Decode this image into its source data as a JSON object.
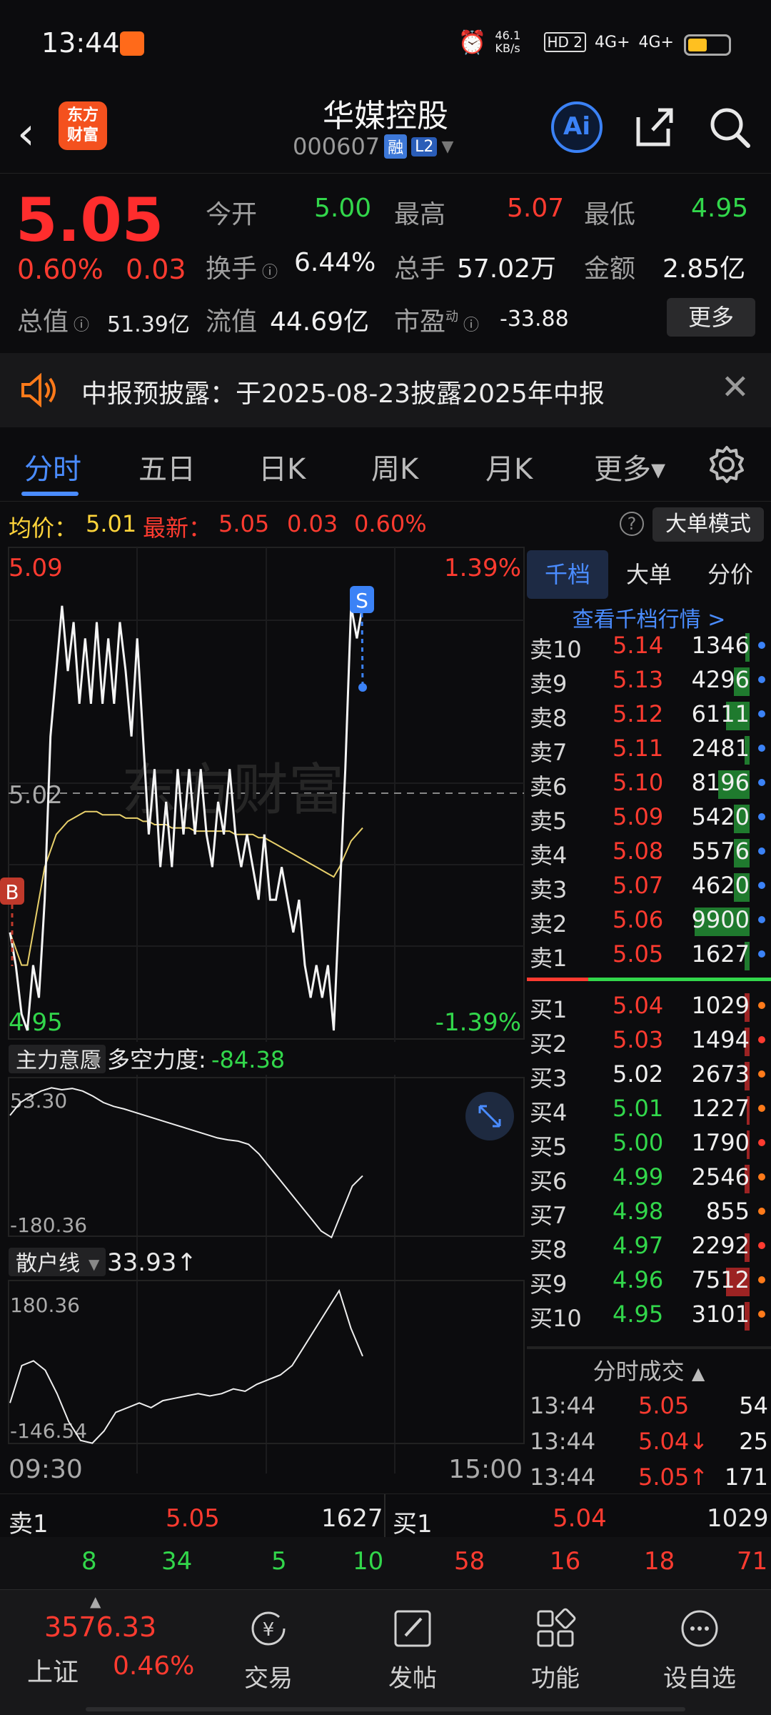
{
  "status": {
    "time": "13:44",
    "net_speed": "46.1 KB/s",
    "hd": "HD 2",
    "sig1": "4G+",
    "sig2": "4G+"
  },
  "header": {
    "back": "‹",
    "logo_text1": "东方",
    "logo_text2": "财富",
    "stock_name": "华媒控股",
    "stock_code": "000607",
    "tag1": "融",
    "tag2": "L2",
    "ai": "Ai"
  },
  "quote": {
    "price": "5.05",
    "change_pct": "0.60%",
    "change_abs": "0.03",
    "open_label": "今开",
    "open": "5.00",
    "high_label": "最高",
    "high": "5.07",
    "low_label": "最低",
    "low": "4.95",
    "turnover_label": "换手",
    "turnover": "6.44%",
    "volume_label": "总手",
    "volume": "57.02万",
    "amount_label": "金额",
    "amount": "2.85亿",
    "total_value_label": "总值",
    "total_value": "51.39亿",
    "float_value_label": "流值",
    "float_value": "44.69亿",
    "pe_label": "市盈",
    "pe_sup": "动",
    "pe": "-33.88",
    "more": "更多"
  },
  "notice": {
    "text": "中报预披露：于2025-08-23披露2025年中报"
  },
  "tabs": [
    {
      "label": "分时"
    },
    {
      "label": "五日"
    },
    {
      "label": "日K"
    },
    {
      "label": "周K"
    },
    {
      "label": "月K"
    },
    {
      "label": "更多▾"
    }
  ],
  "info": {
    "avg_label": "均价：",
    "avg": "5.01",
    "latest_label": "最新：",
    "latest": "5.05",
    "latest_chg": "0.03",
    "latest_pct": "0.60%",
    "big_order_mode": "大单模式"
  },
  "chart_data": {
    "type": "line",
    "price_axis": {
      "top": "5.09",
      "mid": "5.02",
      "bottom": "4.95",
      "top_pct": "1.39%",
      "bottom_pct": "-1.39%"
    },
    "time_axis": {
      "start": "09:30",
      "end": "15:00"
    },
    "watermark": "东方财富",
    "markers": {
      "buy": "B",
      "sell": "S"
    },
    "price_series": [
      4.98,
      4.97,
      4.955,
      4.95,
      4.97,
      4.96,
      4.99,
      5.04,
      5.06,
      5.08,
      5.06,
      5.075,
      5.05,
      5.07,
      5.05,
      5.075,
      5.05,
      5.07,
      5.05,
      5.075,
      5.06,
      5.04,
      5.07,
      5.04,
      5.01,
      5.03,
      5.0,
      5.02,
      5.0,
      5.03,
      5.01,
      5.03,
      5.01,
      5.03,
      5.01,
      5.0,
      5.02,
      5.01,
      5.03,
      5.01,
      5.0,
      5.01,
      5.0,
      4.99,
      5.01,
      4.99,
      4.99,
      5.0,
      4.99,
      4.98,
      4.99,
      4.97,
      4.96,
      4.97,
      4.96,
      4.97,
      4.95,
      4.99,
      5.03,
      5.08,
      5.07,
      5.08
    ],
    "avg_series": [
      4.98,
      4.975,
      4.97,
      4.97,
      4.98,
      4.99,
      5.0,
      5.005,
      5.01,
      5.012,
      5.014,
      5.015,
      5.016,
      5.017,
      5.017,
      5.017,
      5.016,
      5.016,
      5.016,
      5.016,
      5.015,
      5.015,
      5.015,
      5.014,
      5.014,
      5.013,
      5.013,
      5.013,
      5.012,
      5.012,
      5.012,
      5.012,
      5.011,
      5.011,
      5.011,
      5.011,
      5.011,
      5.011,
      5.011,
      5.01,
      5.01,
      5.01,
      5.01,
      5.009,
      5.009,
      5.008,
      5.007,
      5.006,
      5.005,
      5.004,
      5.003,
      5.002,
      5.001,
      5.0,
      4.999,
      4.998,
      4.997,
      5.0,
      5.004,
      5.008,
      5.01,
      5.012
    ],
    "indicator1": {
      "name": "主力意愿",
      "label": "多空力度:",
      "value": "-84.38",
      "max": "53.30",
      "min": "-180.36",
      "series": [
        10,
        30,
        40,
        48,
        53,
        50,
        52,
        48,
        40,
        30,
        24,
        20,
        15,
        10,
        5,
        0,
        -5,
        -10,
        -15,
        -20,
        -25,
        -28,
        -30,
        -35,
        -50,
        -70,
        -90,
        -110,
        -130,
        -150,
        -170,
        -180,
        -140,
        -100,
        -84
      ]
    },
    "indicator2": {
      "name": "散户线",
      "value": "33.93↑",
      "max": "180.36",
      "min": "-146.54",
      "series": [
        -60,
        20,
        30,
        10,
        -40,
        -100,
        -140,
        -146,
        -120,
        -80,
        -70,
        -60,
        -70,
        -55,
        -50,
        -45,
        -40,
        -45,
        -40,
        -30,
        -35,
        -20,
        -10,
        0,
        20,
        60,
        100,
        140,
        180,
        100,
        40
      ]
    }
  },
  "orderbook": {
    "tabs": [
      {
        "label": "千档"
      },
      {
        "label": "大单"
      },
      {
        "label": "分价"
      }
    ],
    "link": "查看千档行情 >",
    "sell": [
      {
        "label": "卖10",
        "price": "5.14",
        "vol": "1346",
        "bar": 0.05
      },
      {
        "label": "卖9",
        "price": "5.13",
        "vol": "4296",
        "bar": 0.2
      },
      {
        "label": "卖8",
        "price": "5.12",
        "vol": "6111",
        "bar": 0.3
      },
      {
        "label": "卖7",
        "price": "5.11",
        "vol": "2481",
        "bar": 0.06
      },
      {
        "label": "卖6",
        "price": "5.10",
        "vol": "8196",
        "bar": 0.4
      },
      {
        "label": "卖5",
        "price": "5.09",
        "vol": "5420",
        "bar": 0.2
      },
      {
        "label": "卖4",
        "price": "5.08",
        "vol": "5576",
        "bar": 0.2
      },
      {
        "label": "卖3",
        "price": "5.07",
        "vol": "4620",
        "bar": 0.2
      },
      {
        "label": "卖2",
        "price": "5.06",
        "vol": "9900",
        "bar": 0.7
      },
      {
        "label": "卖1",
        "price": "5.05",
        "vol": "1627",
        "bar": 0.06
      }
    ],
    "buy": [
      {
        "label": "买1",
        "price": "5.04",
        "vol": "1029",
        "bar": 0.06
      },
      {
        "label": "买2",
        "price": "5.03",
        "vol": "1494",
        "bar": 0.06
      },
      {
        "label": "买3",
        "price": "5.02",
        "vol": "2673",
        "bar": 0.06
      },
      {
        "label": "买4",
        "price": "5.01",
        "vol": "1227",
        "bar": 0.04
      },
      {
        "label": "买5",
        "price": "5.00",
        "vol": "1790",
        "bar": 0.04
      },
      {
        "label": "买6",
        "price": "4.99",
        "vol": "2546",
        "bar": 0.06
      },
      {
        "label": "买7",
        "price": "4.98",
        "vol": "855",
        "bar": 0.0
      },
      {
        "label": "买8",
        "price": "4.97",
        "vol": "2292",
        "bar": 0.06
      },
      {
        "label": "买9",
        "price": "4.96",
        "vol": "7512",
        "bar": 0.3
      },
      {
        "label": "买10",
        "price": "4.95",
        "vol": "3101",
        "bar": 0.06
      }
    ],
    "trades_title": "分时成交",
    "trades": [
      {
        "time": "13:44",
        "price": "5.05",
        "vol": "54"
      },
      {
        "time": "13:44",
        "price": "5.04↓",
        "vol": "25"
      },
      {
        "time": "13:44",
        "price": "5.05↑",
        "vol": "171"
      }
    ]
  },
  "summary": {
    "sell_label": "卖1",
    "sell_price": "5.05",
    "sell_vol": "1627",
    "buy_label": "买1",
    "buy_price": "5.04",
    "buy_vol": "1029",
    "sell_counts": [
      "8",
      "34",
      "5",
      "10"
    ],
    "buy_counts": [
      "58",
      "16",
      "18",
      "71"
    ]
  },
  "nav": {
    "index_value": "3576.33",
    "index_name": "上证",
    "index_pct": "0.46%",
    "items": [
      {
        "label": "交易"
      },
      {
        "label": "发帖"
      },
      {
        "label": "功能"
      },
      {
        "label": "设自选"
      }
    ]
  }
}
